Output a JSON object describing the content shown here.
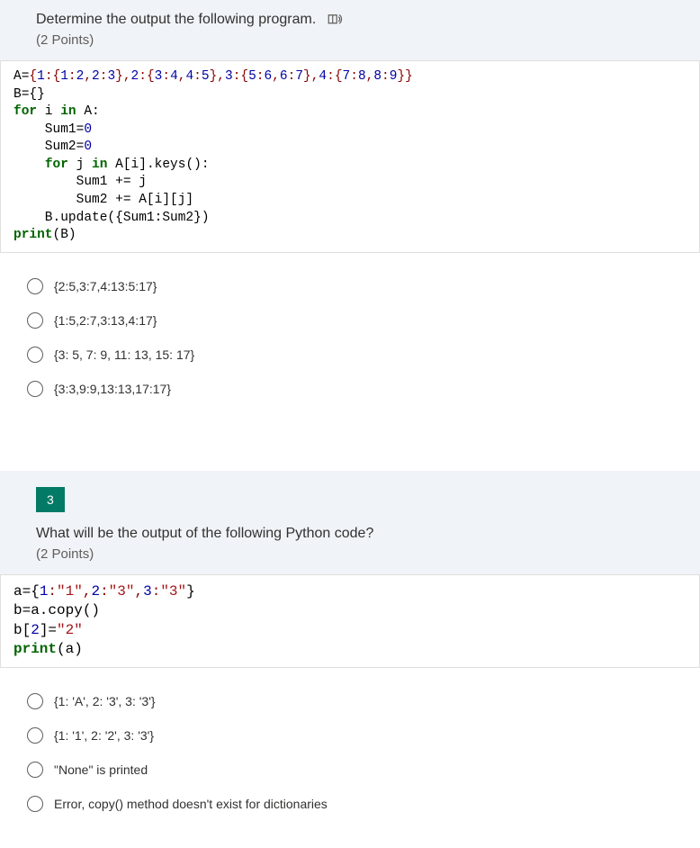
{
  "q2": {
    "prompt": "Determine the output the following program.",
    "points": "(2 Points)",
    "code": {
      "l1a": "A=",
      "l1b": "{",
      "l1c": "1",
      "l1d": ":{",
      "l1e": "1",
      "l1f": ":",
      "l1g": "2",
      "l1h": ",",
      "l1i": "2",
      "l1j": ":",
      "l1k": "3",
      "l1l": "},",
      "l1m": "2",
      "l1n": ":{",
      "l1o": "3",
      "l1p": ":",
      "l1q": "4",
      "l1r": ",",
      "l1s": "4",
      "l1t": ":",
      "l1u": "5",
      "l1v": "},",
      "l1w": "3",
      "l1x": ":{",
      "l1y": "5",
      "l1z": ":",
      "l1aa": "6",
      "l1ab": ",",
      "l1ac": "6",
      "l1ad": ":",
      "l1ae": "7",
      "l1af": "},",
      "l1ag": "4",
      "l1ah": ":{",
      "l1ai": "7",
      "l1aj": ":",
      "l1ak": "8",
      "l1al": ",",
      "l1am": "8",
      "l1an": ":",
      "l1ao": "9",
      "l1ap": "}}",
      "l2": "B={}",
      "l3a": "for",
      "l3b": " i ",
      "l3c": "in",
      "l3d": " A:",
      "l4a": "    Sum1=",
      "l4b": "0",
      "l5a": "    Sum2=",
      "l5b": "0",
      "l6a": "    ",
      "l6b": "for",
      "l6c": " j ",
      "l6d": "in",
      "l6e": " A[i].keys():",
      "l7": "        Sum1 += j",
      "l8": "        Sum2 += A[i][j]",
      "l9": "    B.update({Sum1:Sum2})",
      "l10a": "print",
      "l10b": "(B)"
    },
    "options": [
      "{2:5,3:7,4:13:5:17}",
      "{1:5,2:7,3:13,4:17}",
      "{3: 5, 7: 9, 11: 13, 15: 17}",
      "{3:3,9:9,13:13,17:17}"
    ]
  },
  "q3": {
    "number": "3",
    "prompt": "What will be the output of the following Python code?",
    "points": "(2 Points)",
    "code": {
      "l1a": "a={",
      "l1b": "1",
      "l1c": ":",
      "l1d": "\"1\"",
      "l1e": ",",
      "l1f": "2",
      "l1g": ":",
      "l1h": "\"3\"",
      "l1i": ",",
      "l1j": "3",
      "l1k": ":",
      "l1l": "\"3\"",
      "l1m": "}",
      "l2": "b=a.copy()",
      "l3a": "b[",
      "l3b": "2",
      "l3c": "]=",
      "l3d": "\"2\"",
      "l4a": "print",
      "l4b": "(a)"
    },
    "options": [
      "{1: 'A', 2: '3', 3: '3'}",
      "{1: '1', 2: '2', 3: '3'}",
      "\"None\" is printed",
      "Error, copy() method doesn't exist for dictionaries"
    ]
  }
}
